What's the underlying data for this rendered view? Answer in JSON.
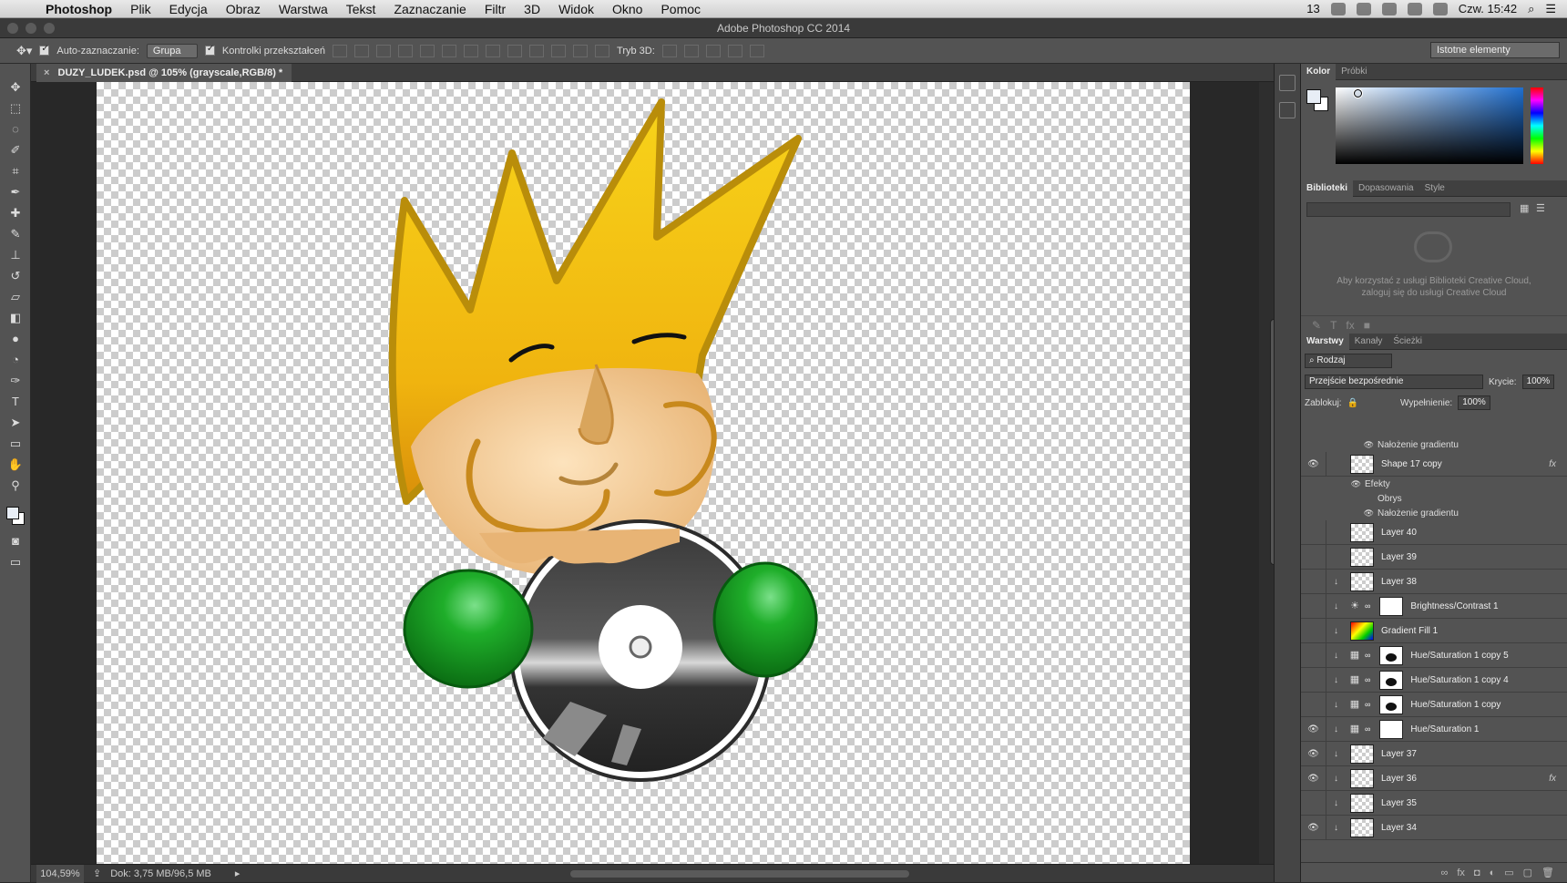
{
  "menubar": {
    "apple": "",
    "items": [
      "Photoshop",
      "Plik",
      "Edycja",
      "Obraz",
      "Warstwa",
      "Tekst",
      "Zaznaczanie",
      "Filtr",
      "3D",
      "Widok",
      "Okno",
      "Pomoc"
    ],
    "tray_badge": "13",
    "clock": "Czw. 15:42"
  },
  "window": {
    "title": "Adobe Photoshop CC 2014"
  },
  "options": {
    "auto_select_label": "Auto-zaznaczanie:",
    "auto_select_value": "Grupa",
    "transform_controls_label": "Kontrolki przekształceń",
    "mode3d_label": "Tryb 3D:",
    "workspace": "Istotne elementy"
  },
  "document": {
    "tab_title": "DUZY_LUDEK.psd @ 105% (grayscale,RGB/8) *",
    "zoom": "104,59%",
    "doc_info": "Dok: 3,75 MB/96,5 MB"
  },
  "tools": [
    "move-icon",
    "marquee-icon",
    "lasso-icon",
    "quick-select-icon",
    "crop-icon",
    "eyedropper-icon",
    "healing-icon",
    "brush-icon",
    "stamp-icon",
    "history-brush-icon",
    "eraser-icon",
    "bucket-icon",
    "blur-icon",
    "dodge-icon",
    "pen-icon",
    "type-icon",
    "path-select-icon",
    "rectangle-icon",
    "hand-icon",
    "zoom-icon"
  ],
  "color_panel": {
    "tabs": [
      "Kolor",
      "Próbki"
    ]
  },
  "libraries_panel": {
    "tabs": [
      "Biblioteki",
      "Dopasowania",
      "Style"
    ],
    "message": "Aby korzystać z usługi Biblioteki Creative Cloud, zaloguj się do usługi Creative Cloud"
  },
  "layers_panel": {
    "tabs": [
      "Warstwy",
      "Kanały",
      "Ścieżki"
    ],
    "filter": "Rodzaj",
    "blend_mode": "Przejście bezpośrednie",
    "opacity_label": "Krycie:",
    "opacity": "100%",
    "lock_label": "Zablokuj:",
    "fill_label": "Wypełnienie:",
    "fill": "100%",
    "rows": [
      {
        "type": "sub",
        "name": "Nałożenie gradientu",
        "indent": 1
      },
      {
        "type": "layer",
        "name": "Shape 17 copy",
        "visible": true,
        "fx": true,
        "thumb": "checker"
      },
      {
        "type": "sub",
        "name": "Efekty",
        "indent": 0
      },
      {
        "type": "sub",
        "name": "Obrys",
        "indent": 1
      },
      {
        "type": "sub",
        "name": "Nałożenie gradientu",
        "indent": 1
      },
      {
        "type": "layer",
        "name": "Layer 40",
        "visible": false,
        "thumb": "checker"
      },
      {
        "type": "layer",
        "name": "Layer 39",
        "visible": false,
        "thumb": "checker"
      },
      {
        "type": "layer",
        "name": "Layer 38",
        "visible": false,
        "clip": true,
        "thumb": "checker"
      },
      {
        "type": "layer",
        "name": "Brightness/Contrast 1",
        "visible": false,
        "clip": true,
        "adj": "☀",
        "thumb": "white"
      },
      {
        "type": "layer",
        "name": "Gradient Fill 1",
        "visible": false,
        "clip": true,
        "thumb": "grad"
      },
      {
        "type": "layer",
        "name": "Hue/Saturation 1 copy 5",
        "visible": false,
        "clip": true,
        "adj": "▦",
        "thumb": "mask"
      },
      {
        "type": "layer",
        "name": "Hue/Saturation 1 copy 4",
        "visible": false,
        "clip": true,
        "adj": "▦",
        "thumb": "mask"
      },
      {
        "type": "layer",
        "name": "Hue/Saturation 1 copy",
        "visible": false,
        "clip": true,
        "adj": "▦",
        "thumb": "mask"
      },
      {
        "type": "layer",
        "name": "Hue/Saturation 1",
        "visible": true,
        "clip": true,
        "adj": "▦",
        "thumb": "white"
      },
      {
        "type": "layer",
        "name": "Layer 37",
        "visible": true,
        "clip": true,
        "thumb": "checker"
      },
      {
        "type": "layer",
        "name": "Layer 36",
        "visible": true,
        "clip": true,
        "fx": true,
        "thumb": "checker"
      },
      {
        "type": "layer",
        "name": "Layer 35",
        "visible": false,
        "clip": true,
        "thumb": "checker"
      },
      {
        "type": "layer",
        "name": "Layer 34",
        "visible": true,
        "clip": true,
        "thumb": "checker"
      }
    ]
  },
  "colors": {
    "accent": "#1f6fd0",
    "panel": "#535353",
    "bg": "#282828"
  }
}
